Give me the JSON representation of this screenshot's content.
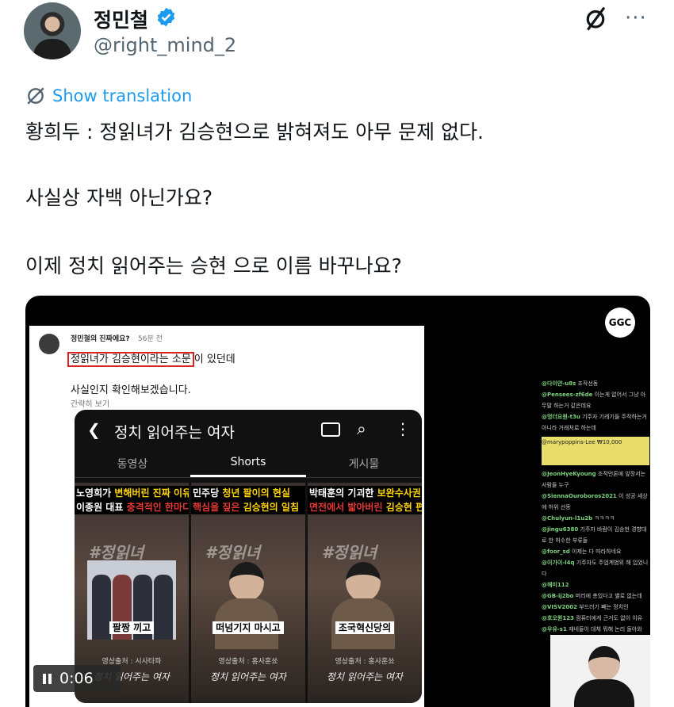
{
  "author": {
    "name": "정민철",
    "handle": "@right_mind_2"
  },
  "translate_label": "Show translation",
  "tweet": {
    "lines": [
      "황희두 : 정읽녀가 김승현으로 밝혀져도 아무 문제 없다.",
      "사실상 자백 아닌가요?",
      "이제 정치 읽어주는 승현 으로 이름 바꾸나요?"
    ]
  },
  "media": {
    "post": {
      "author": "정민철의 진짜에요?",
      "time": "56분 전",
      "highlight": "정읽녀가 김승현이라는 소문",
      "line1_rest": "이 있던데",
      "line2": "사실인지 확인해보겠습니다.",
      "line3": "간략히 보기"
    },
    "youtube": {
      "title": "정치 읽어주는 여자",
      "tabs": [
        "동영상",
        "Shorts",
        "게시물"
      ],
      "shorts": [
        {
          "title_a": "노영희가 ",
          "title_b": "변해버린 진짜 이유",
          "title_c": "이종원 대표 ",
          "title_d": "충격적인 한마디",
          "caption": "팔짱 끼고",
          "source": "영상출처 : 시사타파",
          "footer": "정치 읽어주는 여자"
        },
        {
          "title_a": "민주당 ",
          "title_b": "청년 팔이의 현실",
          "title_c": "핵심을 짚은 ",
          "title_d": "김승현의 일침",
          "caption": "떠넘기지 마시고",
          "source": "영상출처 : 홍사훈쑈",
          "footer": "정치 읽어주는 여자"
        },
        {
          "title_a": "박태훈의 기괴한 ",
          "title_b": "보완수사권 선동",
          "title_c": "면전에서 밟아버린 ",
          "title_d": "김승현 편집장",
          "caption": "조국혁신당의",
          "source": "영상출처 : 홍사훈쑈",
          "footer": "정치 읽어주는 여자"
        }
      ],
      "hashtag": "#정읽녀"
    },
    "stream_logo": "GGC",
    "chat_lines": [
      {
        "user": "@다이얀-u8s",
        "text": "조작선동"
      },
      {
        "user": "@Pensees-zf6de",
        "text": "이는게 없어서 그냥 아무말 하는거 같은데요"
      },
      {
        "user": "@멍더요원-t3u",
        "text": "기주자 기레기들 주작하는거 아니라 거래처로 하는데"
      },
      {
        "user": "@marypoppins-Lee",
        "text": "₩10,000"
      },
      {
        "user": "@JeonHyeKyoung",
        "text": "조작언론에 앞장서는 사람들 누구"
      },
      {
        "user": "@SiennaOuroboros2021",
        "text": "이 성공 세상에 허위 선동"
      },
      {
        "user": "@Chulyun-l1u2b",
        "text": "ㅋㅋㅋㅋ"
      },
      {
        "user": "@jingu6380",
        "text": "기주자 바람이 김승현 경향대로 한 허수한 부류들"
      },
      {
        "user": "@foor_sd",
        "text": "이제는 다 따라하네요"
      },
      {
        "user": "@이가이-l4q",
        "text": "기주자도 주업계범위 해 입었니다"
      },
      {
        "user": "@헤미112",
        "text": ""
      },
      {
        "user": "@GB-ij2bo",
        "text": "머리에 총있다고 별로 없는데"
      },
      {
        "user": "@VISV2002",
        "text": "부드러기 빼는 정치인"
      },
      {
        "user": "@호오원123",
        "text": "컴퓨터에게 근거도 없이 이유"
      },
      {
        "user": "@우유-s1",
        "text": "재네들이 대체 뭐해 논리 돌아와"
      }
    ],
    "player": {
      "time": "0:06"
    }
  }
}
